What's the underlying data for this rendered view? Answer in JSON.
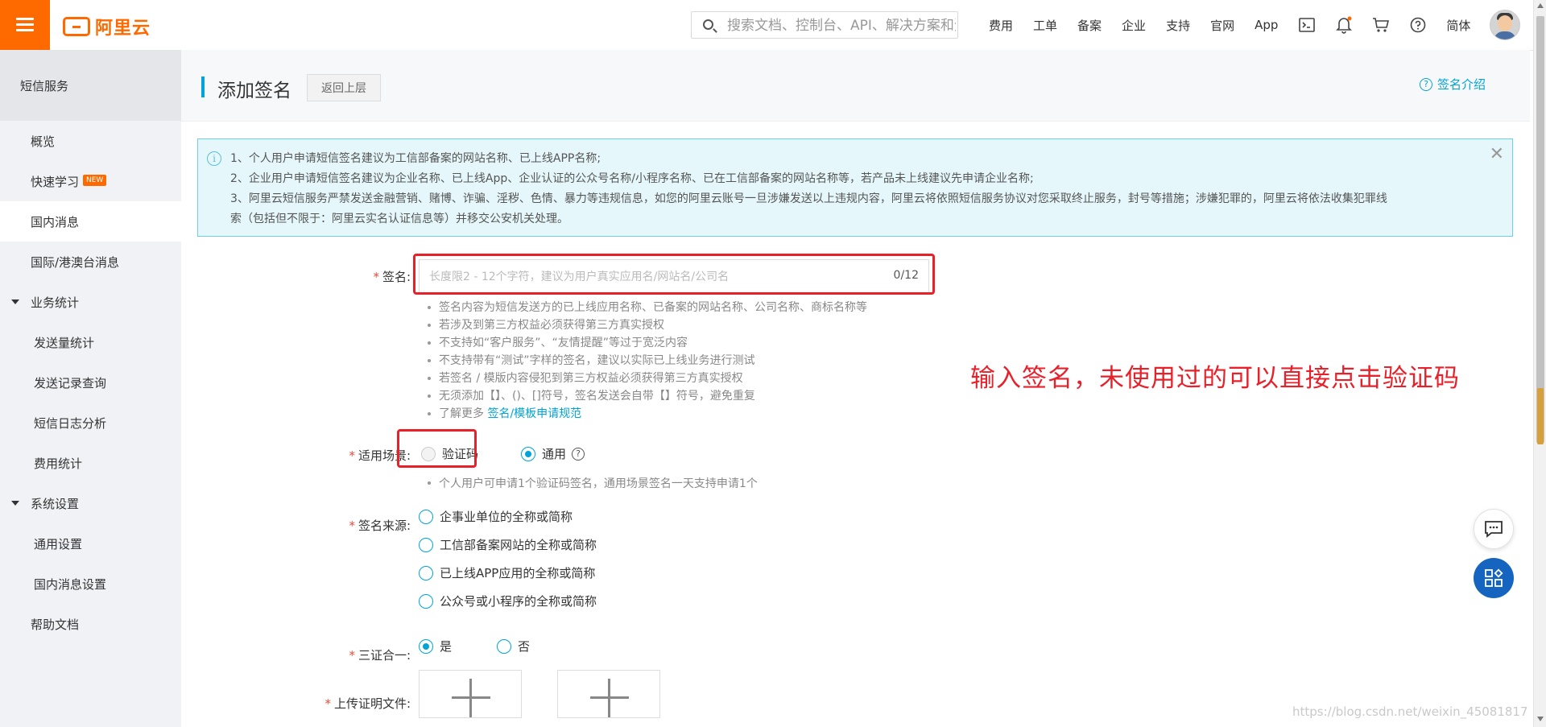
{
  "header": {
    "logo_text": "阿里云",
    "search_placeholder": "搜索文档、控制台、API、解决方案和资源",
    "nav": [
      "费用",
      "工单",
      "备案",
      "企业",
      "支持",
      "官网",
      "App"
    ],
    "lang": "简体",
    "icons": [
      "terminal-icon",
      "bell-icon",
      "cart-icon",
      "help-icon"
    ]
  },
  "sidebar": {
    "title": "短信服务",
    "items": [
      {
        "label": "概览"
      },
      {
        "label": "快速学习",
        "badge": "NEW"
      },
      {
        "label": "国内消息",
        "active": true
      },
      {
        "label": "国际/港澳台消息"
      },
      {
        "label": "业务统计",
        "group": true
      },
      {
        "label": "发送量统计"
      },
      {
        "label": "发送记录查询"
      },
      {
        "label": "短信日志分析"
      },
      {
        "label": "费用统计"
      },
      {
        "label": "系统设置",
        "group": true
      },
      {
        "label": "通用设置"
      },
      {
        "label": "国内消息设置"
      },
      {
        "label": "帮助文档"
      }
    ]
  },
  "page": {
    "title": "添加签名",
    "back_label": "返回上层",
    "intro_link": "签名介绍"
  },
  "notice": {
    "lines": [
      "1、个人用户申请短信签名建议为工信部备案的网站名称、已上线APP名称;",
      "2、企业用户申请短信签名建议为企业名称、已上线App、企业认证的公众号名称/小程序名称、已在工信部备案的网站名称等，若产品未上线建议先申请企业名称;",
      "3、阿里云短信服务严禁发送金融营销、赌博、诈骗、淫秽、色情、暴力等违规信息，如您的阿里云账号一旦涉嫌发送以上违规内容，阿里云将依照短信服务协议对您采取终止服务，封号等措施；涉嫌犯罪的，阿里云将依法收集犯罪线",
      "索（包括但不限于：阿里云实名认证信息等）并移交公安机关处理。"
    ]
  },
  "form": {
    "signature": {
      "label": "签名:",
      "placeholder": "长度限2 - 12个字符，建议为用户真实应用名/网站名/公司名",
      "count": "0/12",
      "hints": [
        "签名内容为短信发送方的已上线应用名称、已备案的网站名称、公司名称、商标名称等",
        "若涉及到第三方权益必须获得第三方真实授权",
        "不支持如“客户服务”、“友情提醒”等过于宽泛内容",
        "不支持带有“测试”字样的签名，建议以实际已上线业务进行测试",
        "若签名 / 模版内容侵犯到第三方权益必须获得第三方真实授权",
        "无须添加【】、()、[]符号，签名发送会自带【】符号，避免重复"
      ],
      "more_prefix": "了解更多",
      "more_link": "签名/模板申请规范"
    },
    "scene": {
      "label": "适用场景:",
      "option_verify": "验证码",
      "option_general": "通用",
      "hint": "个人用户可申请1个验证码签名，通用场景签名一天支持申请1个"
    },
    "source": {
      "label": "签名来源:",
      "options": [
        "企事业单位的全称或简称",
        "工信部备案网站的全称或简称",
        "已上线APP应用的全称或简称",
        "公众号或小程序的全称或简称"
      ]
    },
    "three_in_one": {
      "label": "三证合一:",
      "yes": "是",
      "no": "否"
    },
    "upload": {
      "label": "上传证明文件:"
    }
  },
  "annotation": "输入签名，未使用过的可以直接点击验证码",
  "watermark": "https://blog.csdn.net/weixin_45081817",
  "colors": {
    "brand": "#ff6a00",
    "accent": "#00a4d8",
    "annotation": "#e8202a"
  }
}
